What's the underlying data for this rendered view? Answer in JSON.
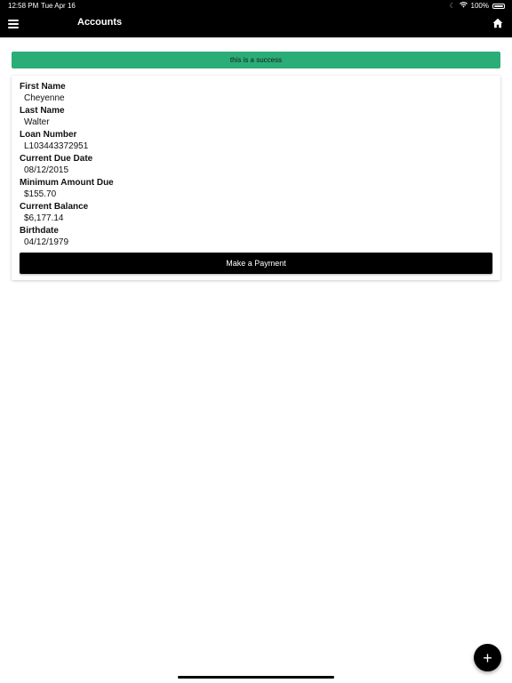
{
  "status_bar": {
    "time": "12:58 PM",
    "date": "Tue Apr 16",
    "battery": "100%"
  },
  "header": {
    "title": "Accounts",
    "menu_icon": "hamburger-menu-icon",
    "home_icon": "home-icon"
  },
  "alert": {
    "message": "this is a success",
    "color": "#2aad77"
  },
  "account": {
    "fields": [
      {
        "label": "First Name",
        "value": "Cheyenne"
      },
      {
        "label": "Last Name",
        "value": "Walter"
      },
      {
        "label": "Loan Number",
        "value": "L103443372951"
      },
      {
        "label": "Current Due Date",
        "value": "08/12/2015"
      },
      {
        "label": "Minimum Amount Due",
        "value": "$155.70"
      },
      {
        "label": "Current Balance",
        "value": "$6,177.14"
      },
      {
        "label": "Birthdate",
        "value": "04/12/1979"
      }
    ],
    "pay_button_label": "Make a Payment"
  },
  "fab": {
    "icon": "plus-icon",
    "glyph": "+"
  }
}
